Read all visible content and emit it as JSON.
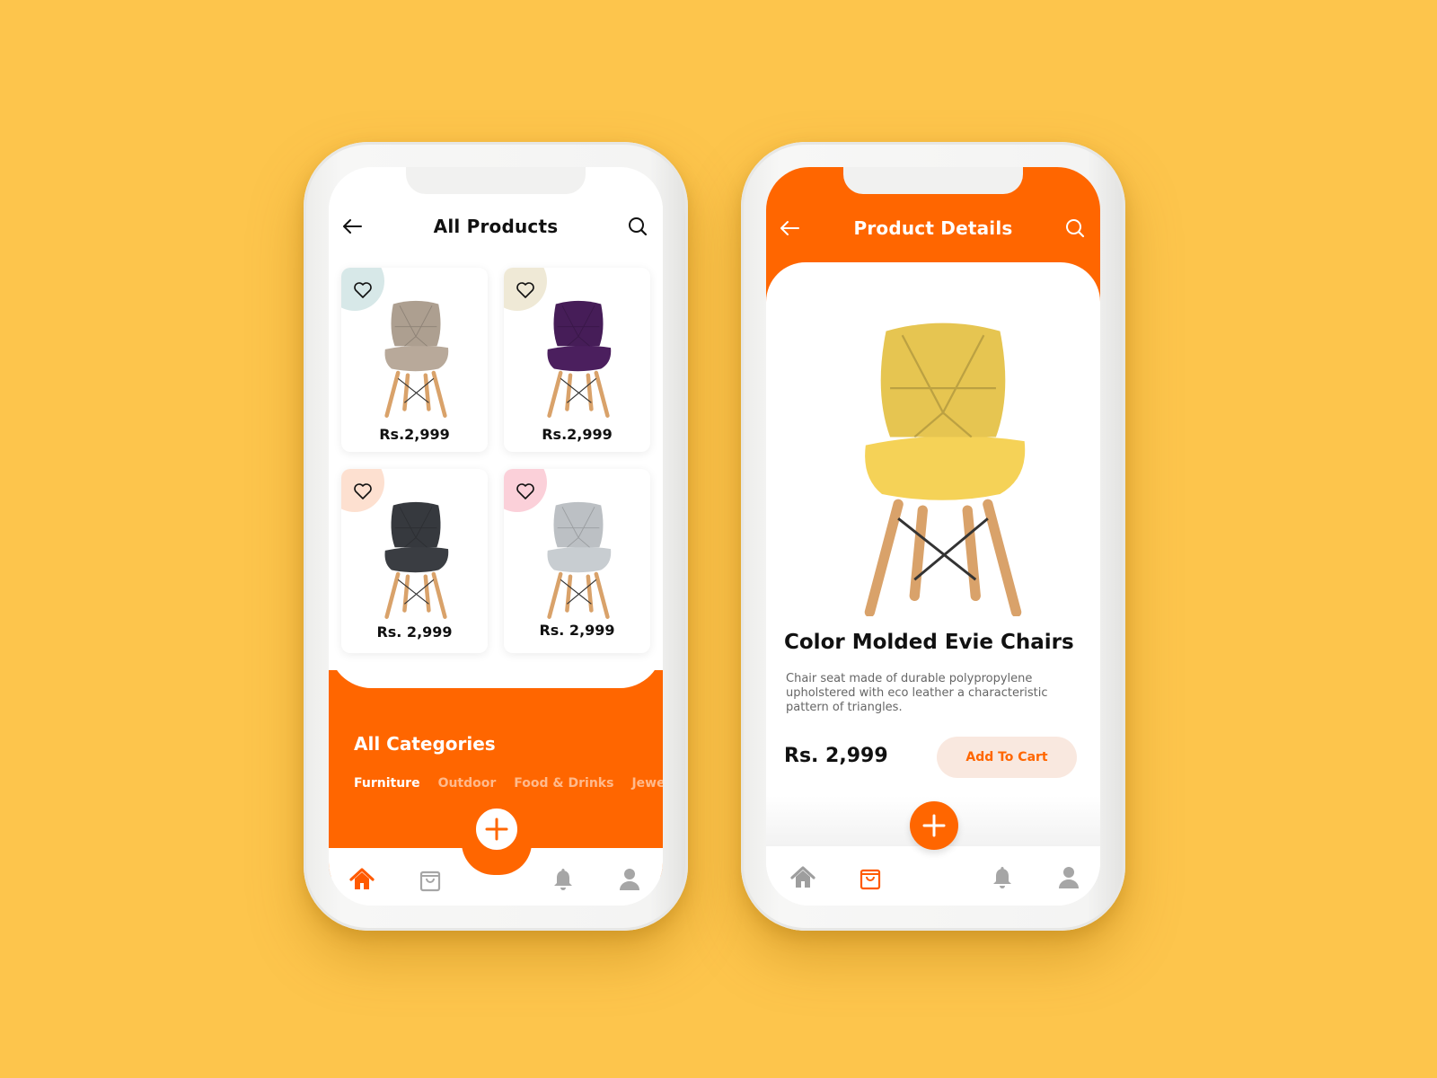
{
  "colors": {
    "background": "#fdc54c",
    "accent": "#ff6600",
    "icon_inactive": "#9e9e9e",
    "add_to_cart_bg": "#f9e8df"
  },
  "all_products_screen": {
    "header": {
      "title": "All Products",
      "back_icon": "arrow-left-icon",
      "search_icon": "search-icon"
    },
    "products": [
      {
        "price": "Rs.2,999",
        "chair_color": "#b8a99a",
        "blob_color": "#d7e8e8",
        "icon": "heart-outline-icon"
      },
      {
        "price": "Rs.2,999",
        "chair_color": "#4b1f5e",
        "blob_color": "#efe9d6",
        "icon": "heart-outline-icon"
      },
      {
        "price": "Rs. 2,999",
        "chair_color": "#3a3d42",
        "blob_color": "#fde0d0",
        "icon": "heart-outline-icon"
      },
      {
        "price": "Rs. 2,999",
        "chair_color": "#c8cdd1",
        "blob_color": "#fbd0d9",
        "icon": "heart-outline-icon"
      }
    ],
    "categories": {
      "title": "All Categories",
      "tabs": [
        "Furniture",
        "Outdoor",
        "Food & Drinks",
        "Jewel"
      ],
      "active_tab": "Furniture"
    },
    "bottom_nav": {
      "items": [
        "home-icon",
        "shopping-bag-icon",
        "bell-icon",
        "user-icon"
      ],
      "active": "home-icon",
      "fab_icon": "plus-icon"
    }
  },
  "product_details_screen": {
    "header": {
      "title": "Product Details",
      "back_icon": "arrow-left-icon",
      "search_icon": "search-icon"
    },
    "product": {
      "name": "Color Molded Evie Chairs",
      "description": "Chair seat made of durable polypropylene upholstered with eco leather a characteristic pattern of triangles.",
      "price": "Rs. 2,999",
      "chair_color": "#f5d257",
      "add_to_cart_label": "Add To Cart"
    },
    "bottom_nav": {
      "items": [
        "home-icon",
        "shopping-bag-icon",
        "bell-icon",
        "user-icon"
      ],
      "active": "shopping-bag-icon",
      "fab_icon": "plus-icon"
    }
  }
}
